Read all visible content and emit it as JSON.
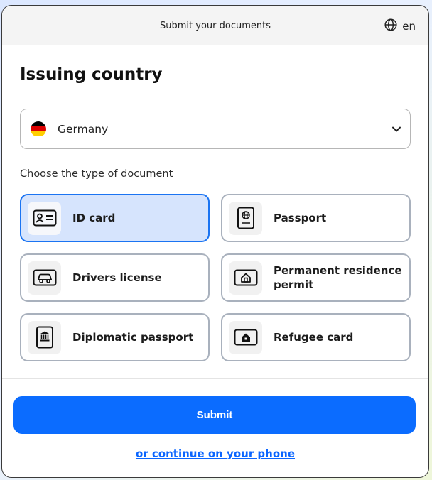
{
  "header": {
    "title": "Submit your documents",
    "language": "en"
  },
  "heading": "Issuing country",
  "country_select": {
    "value": "Germany",
    "flag_colors": [
      "#000000",
      "#dd0000",
      "#ffce00"
    ]
  },
  "document_label": "Choose the type of document",
  "documents": [
    {
      "label": "ID card",
      "icon": "id-card-icon",
      "selected": true
    },
    {
      "label": "Passport",
      "icon": "passport-icon",
      "selected": false
    },
    {
      "label": "Drivers license",
      "icon": "car-icon",
      "selected": false
    },
    {
      "label_line1": "Permanent residence",
      "label_line2": "permit",
      "icon": "residence-permit-icon",
      "selected": false
    },
    {
      "label": "Diplomatic passport",
      "icon": "diplomatic-passport-icon",
      "selected": false
    },
    {
      "label": "Refugee card",
      "icon": "refugee-card-icon",
      "selected": false
    }
  ],
  "submit_label": "Submit",
  "phone_link": "or continue on your phone",
  "colors": {
    "accent": "#0b6cff",
    "selected_bg": "#d6e4fd",
    "selected_border": "#1b74f2"
  }
}
